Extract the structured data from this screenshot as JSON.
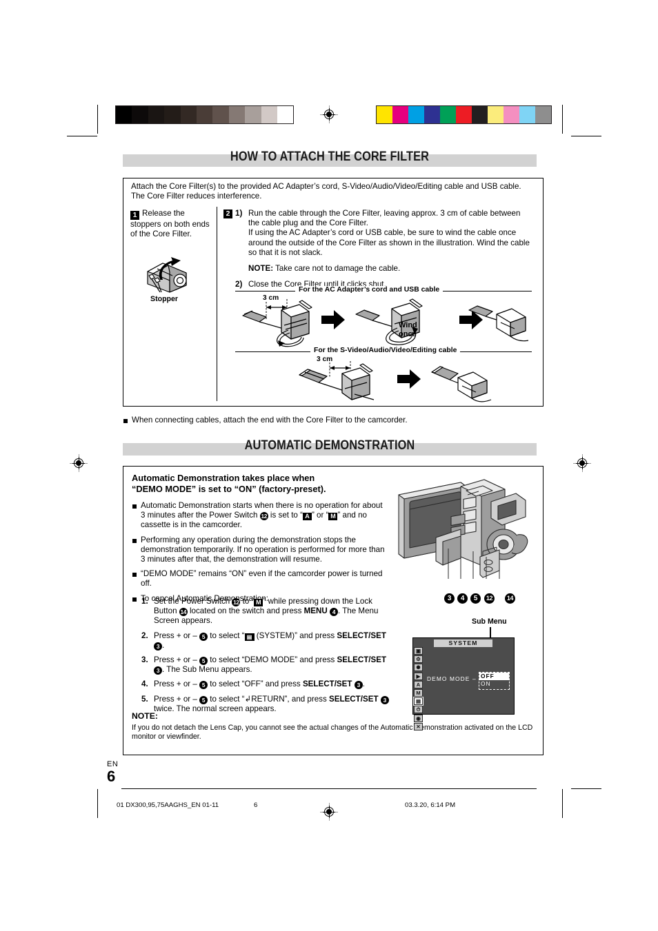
{
  "document": {
    "language_code": "EN",
    "page_number": "6"
  },
  "calibration": {
    "gray_swatches": [
      "#000000",
      "#0d0a0a",
      "#1a1513",
      "#231c18",
      "#332924",
      "#4a3d37",
      "#60524c",
      "#857974",
      "#a89f9b",
      "#d2c9c6",
      "#ffffff"
    ],
    "color_swatches": [
      "#ffe400",
      "#e6007e",
      "#00a0e4",
      "#2e3192",
      "#00a057",
      "#ed1c24",
      "#231f20",
      "#fbec7c",
      "#f48fc0",
      "#7fd4f5",
      "#8e8e8e"
    ]
  },
  "section1": {
    "title": "HOW TO ATTACH THE CORE FILTER",
    "intro": "Attach the Core Filter(s) to the provided AC Adapter’s cord, S-Video/Audio/Video/Editing cable and USB cable. The Core Filter reduces interference.",
    "step1": {
      "badge": "1",
      "text": "Release the stoppers on both ends of the Core Filter.",
      "illustration_label": "Stopper"
    },
    "step2": {
      "badge": "2",
      "item1_number": "1)",
      "item1_text": "Run the cable through the Core Filter, leaving approx. 3 cm of cable between the cable plug and the Core Filter.",
      "item1_text2": "If using the AC Adapter’s cord or USB cable, be sure to wind the cable once around the outside of the Core Filter as shown in the illustration. Wind the cable so that it is not slack.",
      "note_label": "NOTE:",
      "note_text": "Take care not to damage the cable.",
      "item2_number": "2)",
      "item2_text": "Close the Core Filter until it clicks shut."
    },
    "diagram": {
      "caption_top": "For the AC Adapter’s cord and USB cable",
      "caption_bottom": "For the S-Video/Audio/Video/Editing cable",
      "dim_top": "3 cm",
      "dim_bottom": "3 cm",
      "wind_label_line1": "Wind",
      "wind_label_line2": "once"
    },
    "footnote": "When connecting cables, attach the end with the Core Filter to the camcorder."
  },
  "section2": {
    "title": "AUTOMATIC DEMONSTRATION",
    "heading_line1": "Automatic Demonstration takes place when",
    "heading_line2": "“DEMO MODE” is set to “ON” (factory-preset).",
    "bullets": [
      {
        "pre": "Automatic Demonstration starts when there is no operation for about 3 minutes after the Power Switch ",
        "ref1": "12",
        "mid": " is set to “",
        "glyph1": "A",
        "mid2": "” or “",
        "glyph2": "M",
        "post": "” and no cassette is in the camcorder."
      },
      {
        "pre": "Performing any operation during the demonstration stops the demonstration temporarily. If no operation is performed for more than 3 minutes after that, the demonstration will resume."
      },
      {
        "pre": "“DEMO MODE” remains “ON” even if the camcorder power is turned off."
      },
      {
        "pre": "To cancel Automatic Demonstration:"
      }
    ],
    "steps": [
      {
        "n": "1.",
        "a": "Set the Power Switch ",
        "ref1": "12",
        "b": " to “",
        "glyph1": "M",
        "c": "” while pressing down the Lock Button ",
        "ref2": "14",
        "d": " located on the switch and press ",
        "bold1": "MENU",
        "ref3": "4",
        "e": ". The Menu Screen appears."
      },
      {
        "n": "2.",
        "a": "Press + or – ",
        "ref1": "5",
        "b": " to select “",
        "glyph_sys": "SYSTEM-icon",
        "c": " (SYSTEM)” and press ",
        "bold1": "SELECT/SET",
        "ref2": "3",
        "d": "."
      },
      {
        "n": "3.",
        "a": "Press + or – ",
        "ref1": "5",
        "b": " to select “DEMO MODE” and press ",
        "bold1": "SELECT/SET",
        "ref2": "3",
        "c": ". The Sub Menu appears."
      },
      {
        "n": "4.",
        "a": "Press + or – ",
        "ref1": "5",
        "b": " to select “OFF” and press ",
        "bold1": "SELECT/SET",
        "ref2": "3",
        "c": "."
      },
      {
        "n": "5.",
        "a": "Press + or – ",
        "ref1": "5",
        "b": " to select “↲RETURN”, and press ",
        "bold1": "SELECT/SET",
        "ref2": "3",
        "c": " twice. The normal screen appears."
      }
    ],
    "note_label": "NOTE:",
    "note_text": "If you do not detach the Lens Cap, you cannot see the actual changes of the Automatic Demonstration activated on the LCD monitor or viewfinder.",
    "camera_callouts": [
      "3",
      "4",
      "5",
      "12",
      "14"
    ],
    "menu": {
      "sub_menu_label": "Sub Menu",
      "screen_title": "SYSTEM",
      "item_label": "DEMO MODE",
      "options": [
        "OFF",
        "ON"
      ],
      "selected_option": "OFF",
      "icon_column": [
        "tape-icon",
        "camera-mode-icon",
        "effect-icon",
        "playback-icon",
        "auto-A-icon",
        "manual-M-icon",
        "system-icon",
        "clock-icon",
        "camera-icon",
        "exit-icon"
      ],
      "selected_icon_index": 6
    }
  },
  "footer": {
    "filename": "01 DX300,95,75AAGHS_EN 01-11",
    "page": "6",
    "timestamp": "03.3.20, 6:14 PM"
  }
}
